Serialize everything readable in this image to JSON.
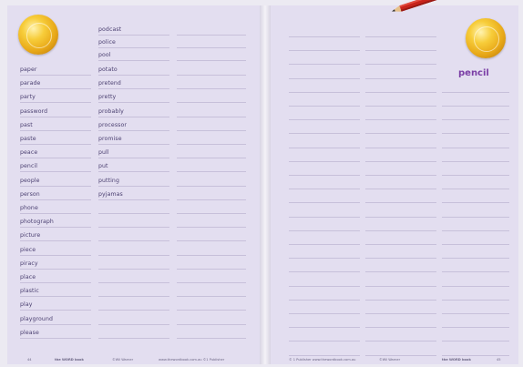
{
  "left_page": {
    "header_words": [
      "podcast",
      "police",
      "pool"
    ],
    "col1": [
      "paper",
      "parade",
      "party",
      "password",
      "past",
      "paste",
      "peace",
      "pencil",
      "people",
      "person",
      "phone",
      "photograph",
      "picture",
      "piece",
      "piracy",
      "place",
      "plastic",
      "play",
      "playground",
      "please"
    ],
    "col2": [
      "potato",
      "pretend",
      "pretty",
      "probably",
      "processor",
      "promise",
      "pull",
      "put",
      "putting",
      "pyjamas"
    ],
    "footer": {
      "page_number": "44",
      "brand": "the WORD book",
      "publisher": "©Wil Warner",
      "website": "www.thewordbook.com.au  ©1 Publisher"
    }
  },
  "right_page": {
    "title_word": "pencil",
    "footer": {
      "copyright": "© 1 Publisher  www.thewordbook.com.au",
      "publisher": "©Wil Warner",
      "brand": "the WORD book",
      "page_number": "45"
    }
  },
  "colors": {
    "page_bg": "#e3def0",
    "rule_line": "#c7c0da",
    "word_text": "#4a3f70",
    "title_word": "#7b3fa6",
    "coin_gold": "#e8a818",
    "pencil_red": "#c8231b"
  },
  "icons": [
    "coin-icon",
    "coin-icon",
    "pencil-icon"
  ]
}
